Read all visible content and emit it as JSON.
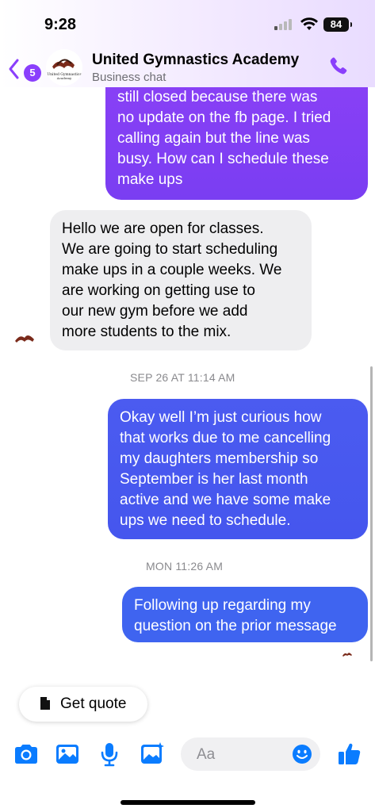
{
  "status_bar": {
    "time": "9:28",
    "battery": "84"
  },
  "header": {
    "back_count": "5",
    "title": "United Gymnastics Academy",
    "subtitle": "Business chat",
    "logo_text_line1": "United Gymnastics",
    "logo_text_line2": "Academy"
  },
  "messages": [
    {
      "from": "me",
      "lines": [
        "still closed because there was",
        "no update on the fb page. I tried",
        "calling again but the line was",
        "busy. How can I schedule these",
        "make ups"
      ]
    },
    {
      "from": "business",
      "lines": [
        "Hello we are open for classes.",
        "We are going to start scheduling",
        "make ups in a couple weeks. We",
        "are working on getting use to",
        "our new gym before we add",
        "more students to the mix."
      ]
    },
    {
      "timestamp": "SEP 26 AT 11:14 AM"
    },
    {
      "from": "me",
      "lines": [
        "Okay well I’m just curious how",
        "that works due to me cancelling",
        "my daughters membership so",
        "September is her last month",
        "active and we have some make",
        "ups we need to schedule."
      ]
    },
    {
      "timestamp": "MON 11:26 AM"
    },
    {
      "from": "me",
      "lines": [
        "Following up regarding my",
        "question on the prior message"
      ]
    }
  ],
  "quick_reply": {
    "label": "Get quote",
    "icon": "document-icon"
  },
  "composer": {
    "placeholder": "Aa",
    "icons": [
      "camera-icon",
      "photo-icon",
      "microphone-icon",
      "sticker-image-icon",
      "emoji-icon",
      "thumbs-up-icon"
    ]
  },
  "colors": {
    "accent": "#8a3ffc",
    "bubble_purple": "#7a3cf4",
    "bubble_blue": "#4556ee",
    "incoming_bubble": "#eeeef0"
  }
}
